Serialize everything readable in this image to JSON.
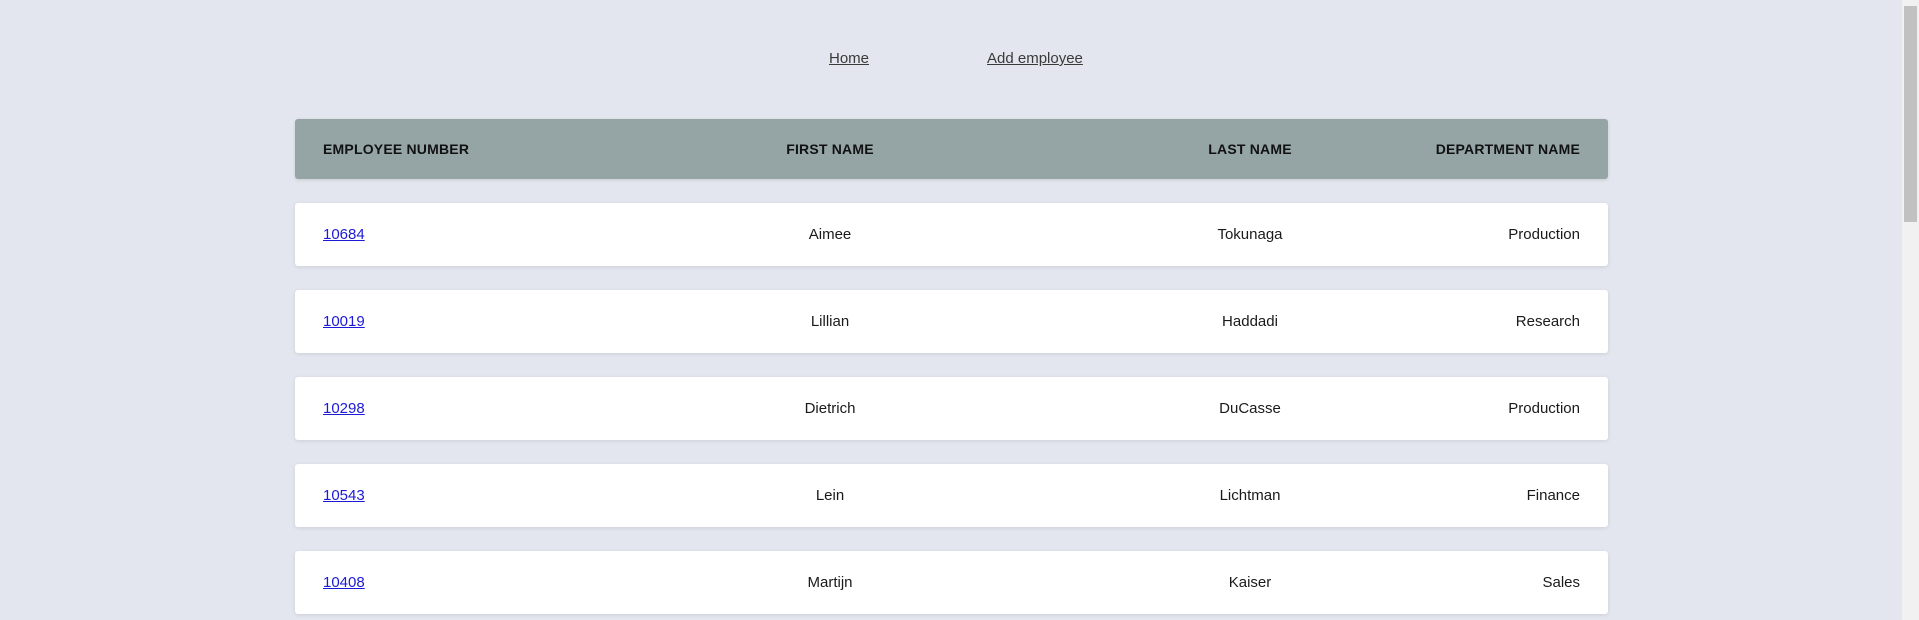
{
  "nav": {
    "home_label": "Home",
    "add_employee_label": "Add employee"
  },
  "table": {
    "headers": [
      "EMPLOYEE NUMBER",
      "FIRST NAME",
      "LAST NAME",
      "DEPARTMENT NAME"
    ],
    "rows": [
      {
        "employee_number": "10684",
        "first_name": "Aimee",
        "last_name": "Tokunaga",
        "department": "Production"
      },
      {
        "employee_number": "10019",
        "first_name": "Lillian",
        "last_name": "Haddadi",
        "department": "Research"
      },
      {
        "employee_number": "10298",
        "first_name": "Dietrich",
        "last_name": "DuCasse",
        "department": "Production"
      },
      {
        "employee_number": "10543",
        "first_name": "Lein",
        "last_name": "Lichtman",
        "department": "Finance"
      },
      {
        "employee_number": "10408",
        "first_name": "Martijn",
        "last_name": "Kaiser",
        "department": "Sales"
      }
    ]
  },
  "colors": {
    "page_background": "#e3e6ee",
    "header_background": "#95a5a6",
    "row_background": "#ffffff",
    "link_color": "#1d1ad6"
  }
}
